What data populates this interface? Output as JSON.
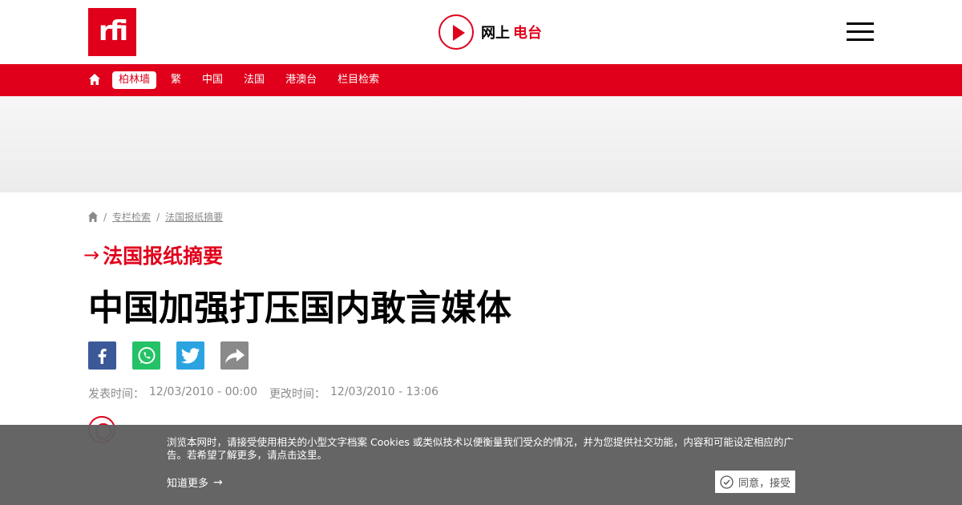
{
  "header": {
    "logo_text": "rfi",
    "radio_label": "网上",
    "radio_accent": "电台",
    "brand_color": "#e0001b"
  },
  "nav": {
    "items": [
      {
        "label": "柏林墙",
        "active": true
      },
      {
        "label": "繁"
      },
      {
        "label": "中国"
      },
      {
        "label": "法国"
      },
      {
        "label": "港澳台"
      },
      {
        "label": "栏目检索"
      }
    ]
  },
  "breadcrumb": [
    "专栏检索",
    "法国报纸摘要"
  ],
  "section": {
    "title": "法国报纸摘要"
  },
  "article": {
    "title": "中国加强打压国内敢言媒体",
    "published_label": "发表时间：",
    "published": "12/03/2010 - 00:00",
    "updated_label": "更改时间：",
    "updated": "12/03/2010 - 13:06"
  },
  "share": {
    "icons": [
      "facebook-icon",
      "whatsapp-icon",
      "twitter-icon",
      "share-icon"
    ]
  },
  "cookie": {
    "text": "浏览本网时，请接受使用相关的小型文字档案 Cookies 或类似技术以便衡量我们受众的情况，并为您提供社交功能，内容和可能设定相应的广告。若希望了解更多，请点击这里。",
    "more_label": "知道更多",
    "accept_label": "同意，接受"
  }
}
